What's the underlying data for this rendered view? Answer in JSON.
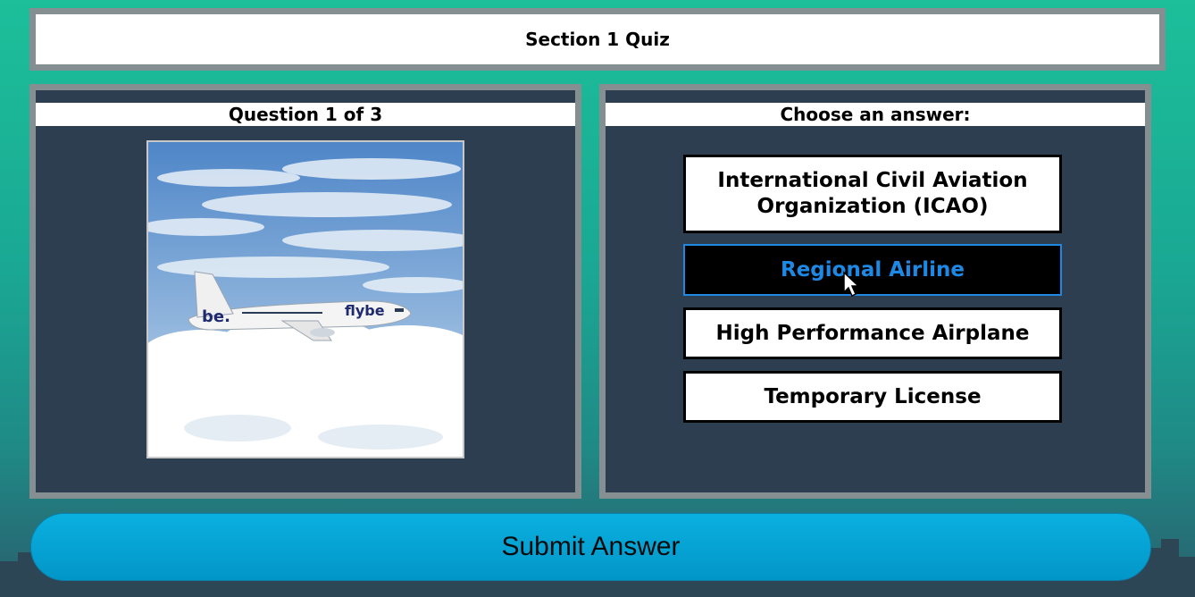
{
  "quiz": {
    "title": "Section 1 Quiz"
  },
  "question_panel": {
    "header": "Question 1 of 3",
    "image_icon": "airplane-in-clouds-image",
    "image_caption_logo": "flybe"
  },
  "answer_panel": {
    "header": "Choose an answer:",
    "options": [
      {
        "label": "International Civil Aviation Organization (ICAO)",
        "selected": false
      },
      {
        "label": "Regional Airline",
        "selected": true
      },
      {
        "label": "High Performance Airplane",
        "selected": false
      },
      {
        "label": "Temporary License",
        "selected": false
      }
    ]
  },
  "submit": {
    "label": "Submit Answer"
  },
  "colors": {
    "background_top": "#1cbf9a",
    "panel_bg": "#2c3e50",
    "panel_border": "#858f92",
    "selected_accent": "#1e88e5",
    "submit_bg": "#02a0d4"
  }
}
